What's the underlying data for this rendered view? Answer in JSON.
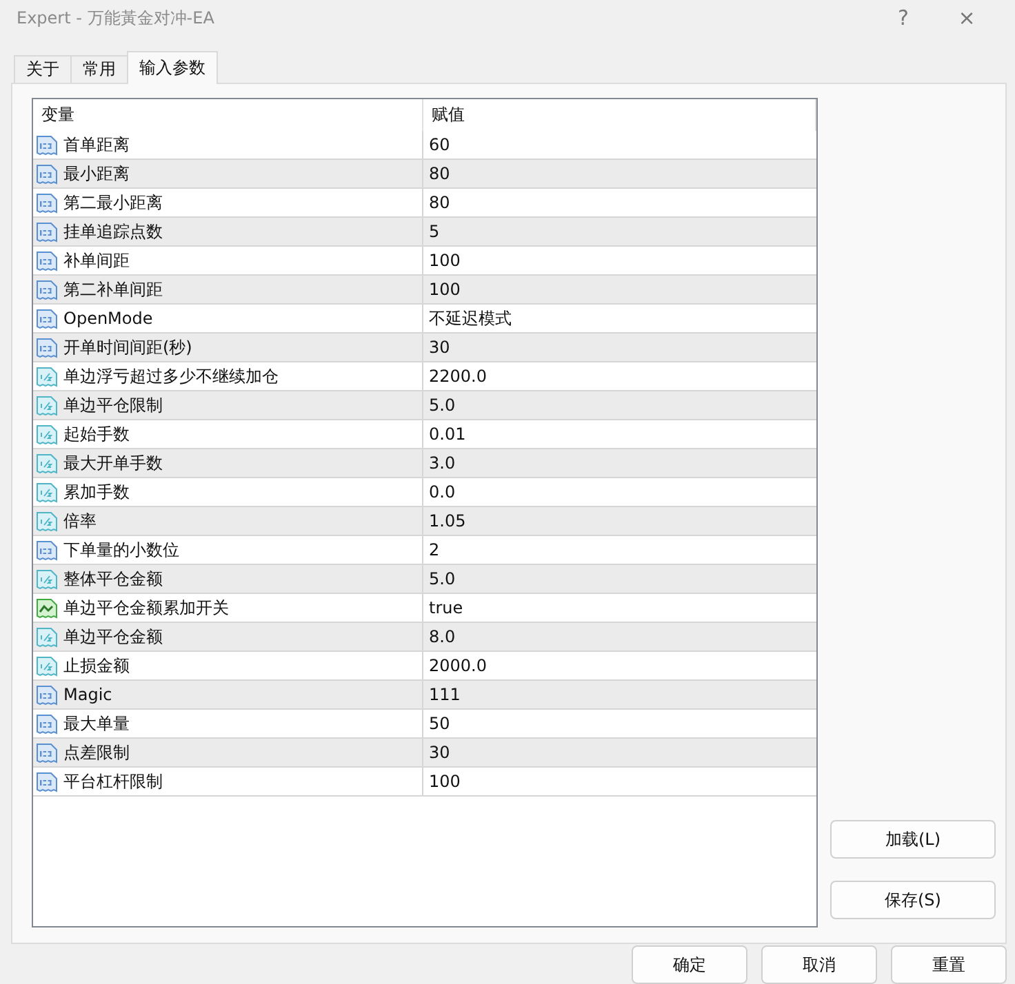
{
  "window": {
    "title": "Expert - 万能黃金对冲-EA",
    "help": "?",
    "close": "×"
  },
  "tabs": [
    {
      "label": "关于",
      "selected": false
    },
    {
      "label": "常用",
      "selected": false
    },
    {
      "label": "输入参数",
      "selected": true
    }
  ],
  "table": {
    "columns": [
      "变量",
      "赋值"
    ],
    "rows": [
      {
        "kind": "int",
        "name": "首单距离",
        "value": "60"
      },
      {
        "kind": "int",
        "name": "最小距离",
        "value": "80"
      },
      {
        "kind": "int",
        "name": "第二最小距离",
        "value": "80"
      },
      {
        "kind": "int",
        "name": "挂单追踪点数",
        "value": "5"
      },
      {
        "kind": "int",
        "name": "补单间距",
        "value": "100"
      },
      {
        "kind": "int",
        "name": "第二补单间距",
        "value": "100"
      },
      {
        "kind": "int",
        "name": "OpenMode",
        "value": "不延迟模式"
      },
      {
        "kind": "int",
        "name": "开单时间间距(秒)",
        "value": "30"
      },
      {
        "kind": "double",
        "name": "单边浮亏超过多少不继续加仓",
        "value": "2200.0"
      },
      {
        "kind": "double",
        "name": "单边平仓限制",
        "value": "5.0"
      },
      {
        "kind": "double",
        "name": "起始手数",
        "value": "0.01"
      },
      {
        "kind": "double",
        "name": "最大开单手数",
        "value": "3.0"
      },
      {
        "kind": "double",
        "name": "累加手数",
        "value": "0.0"
      },
      {
        "kind": "double",
        "name": "倍率",
        "value": "1.05"
      },
      {
        "kind": "int",
        "name": "下单量的小数位",
        "value": "2"
      },
      {
        "kind": "double",
        "name": "整体平仓金额",
        "value": "5.0"
      },
      {
        "kind": "bool",
        "name": "单边平仓金额累加开关",
        "value": "true"
      },
      {
        "kind": "double",
        "name": "单边平仓金额",
        "value": "8.0"
      },
      {
        "kind": "double",
        "name": "止损金额",
        "value": "2000.0"
      },
      {
        "kind": "int",
        "name": "Magic",
        "value": "111"
      },
      {
        "kind": "int",
        "name": "最大单量",
        "value": "50"
      },
      {
        "kind": "int",
        "name": "点差限制",
        "value": "30"
      },
      {
        "kind": "int",
        "name": "平台杠杆限制",
        "value": "100"
      }
    ]
  },
  "side_buttons": [
    "加载(L)",
    "保存(S)"
  ],
  "bottom_buttons": [
    "确定",
    "取消",
    "重置"
  ]
}
